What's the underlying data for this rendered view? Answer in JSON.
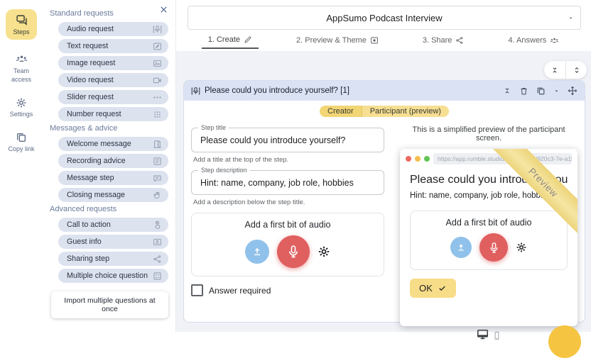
{
  "rail": {
    "items": [
      {
        "label": "Steps"
      },
      {
        "label": "Team access"
      },
      {
        "label": "Settings"
      },
      {
        "label": "Copy link"
      }
    ]
  },
  "panel": {
    "sections": [
      {
        "title": "Standard requests",
        "items": [
          "Audio request",
          "Text request",
          "Image request",
          "Video request",
          "Slider request",
          "Number request"
        ]
      },
      {
        "title": "Messages & advice",
        "items": [
          "Welcome message",
          "Recording advice",
          "Message step",
          "Closing message"
        ]
      },
      {
        "title": "Advanced requests",
        "items": [
          "Call to action",
          "Guest info",
          "Sharing step",
          "Multiple choice question"
        ]
      }
    ],
    "import_button": "Import multiple questions at once"
  },
  "header": {
    "title": "AppSumo Podcast Interview"
  },
  "tabs": [
    {
      "label": "1. Create"
    },
    {
      "label": "2. Preview & Theme"
    },
    {
      "label": "3. Share"
    },
    {
      "label": "4. Answers"
    }
  ],
  "step_card": {
    "title": "Please could you introduce yourself? [1]",
    "mode_toggle": {
      "creator": "Creator",
      "participant": "Participant (preview)"
    },
    "form": {
      "title_label": "Step title",
      "title_value": "Please could you introduce yourself?",
      "title_helper": "Add a title at the top of the step.",
      "description_label": "Step description",
      "description_value": "Hint: name, company, job role, hobbies",
      "description_helper": "Add a description below the step title.",
      "audio_prompt": "Add a first bit of audio",
      "answer_required": "Answer required"
    },
    "preview": {
      "caption": "This is a simplified preview of the participant screen.",
      "url": "https://app.rumble.studio/forms/open/920c3-7e-a152-4b",
      "ribbon": "Preview",
      "title": "Please could you introduce yourself?",
      "hint": "Hint: name, company, job role, hobbies",
      "audio_prompt": "Add a first bit of audio",
      "ok_label": "OK"
    }
  },
  "colors": {
    "accent_yellow": "#f7e18f",
    "step_header_blue": "#dbe2f3",
    "record_red": "#e05f5f",
    "upload_blue": "#90c1ea",
    "ok_yellow": "#f7dd88",
    "fab_yellow": "#f5c440"
  }
}
